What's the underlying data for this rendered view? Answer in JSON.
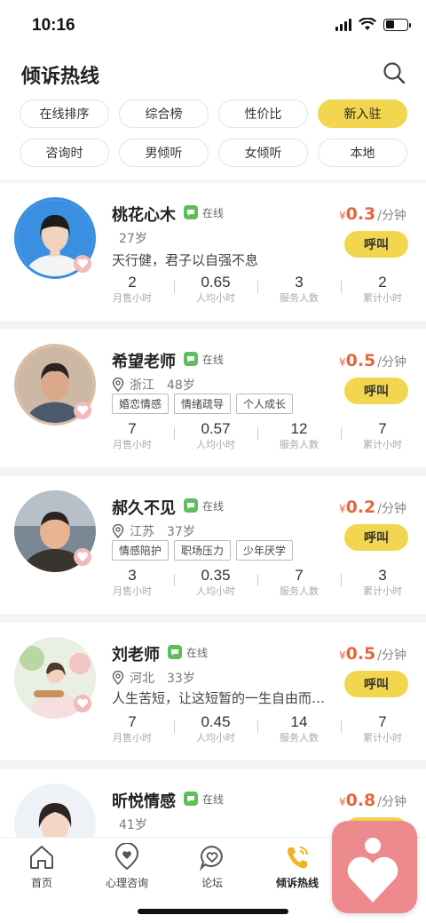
{
  "status_bar": {
    "time": "10:16"
  },
  "header": {
    "title": "倾诉热线"
  },
  "filters": {
    "row1": [
      {
        "label": "在线排序",
        "active": false
      },
      {
        "label": "综合榜",
        "active": false
      },
      {
        "label": "性价比",
        "active": false
      },
      {
        "label": "新入驻",
        "active": true
      }
    ],
    "row2": [
      {
        "label": "咨询时",
        "active": false
      },
      {
        "label": "男倾听",
        "active": false
      },
      {
        "label": "女倾听",
        "active": false
      },
      {
        "label": "本地",
        "active": false
      }
    ]
  },
  "stat_labels": [
    "月售小时",
    "人均小时",
    "服务人数",
    "累计小时"
  ],
  "online_label": "在线",
  "call_label": "呼叫",
  "price_currency": "¥",
  "price_unit": "/分钟",
  "listeners": [
    {
      "name": "桃花心木",
      "location": "",
      "age": "27岁",
      "description": "天行健，君子以自强不息",
      "tags": [],
      "price": "0.3",
      "stats": [
        "2",
        "0.65",
        "3",
        "2"
      ]
    },
    {
      "name": "希望老师",
      "location": "浙江",
      "age": "48岁",
      "description": "",
      "tags": [
        "婚恋情感",
        "情绪疏导",
        "个人成长"
      ],
      "price": "0.5",
      "stats": [
        "7",
        "0.57",
        "12",
        "7"
      ]
    },
    {
      "name": "郝久不见",
      "location": "江苏",
      "age": "37岁",
      "description": "",
      "tags": [
        "情感陪护",
        "职场压力",
        "少年厌学"
      ],
      "price": "0.2",
      "stats": [
        "3",
        "0.35",
        "7",
        "3"
      ]
    },
    {
      "name": "刘老师",
      "location": "河北",
      "age": "33岁",
      "description": "人生苦短，让这短暂的一生自由而…",
      "tags": [],
      "price": "0.5",
      "stats": [
        "7",
        "0.45",
        "14",
        "7"
      ]
    },
    {
      "name": "昕悦情感",
      "location": "",
      "age": "41岁",
      "description": "",
      "tags": [],
      "price": "0.8",
      "stats": []
    }
  ],
  "tabbar": [
    {
      "label": "首页",
      "icon": "home-icon",
      "active": false
    },
    {
      "label": "心理咨询",
      "icon": "heart-location-icon",
      "active": false
    },
    {
      "label": "论坛",
      "icon": "chat-heart-icon",
      "active": false
    },
    {
      "label": "倾诉热线",
      "icon": "phone-icon",
      "active": true
    }
  ],
  "colors": {
    "accent": "#f3d64f",
    "price": "#e5673a",
    "online": "#5cbf5c",
    "brand_pink": "#ec8a8d"
  }
}
